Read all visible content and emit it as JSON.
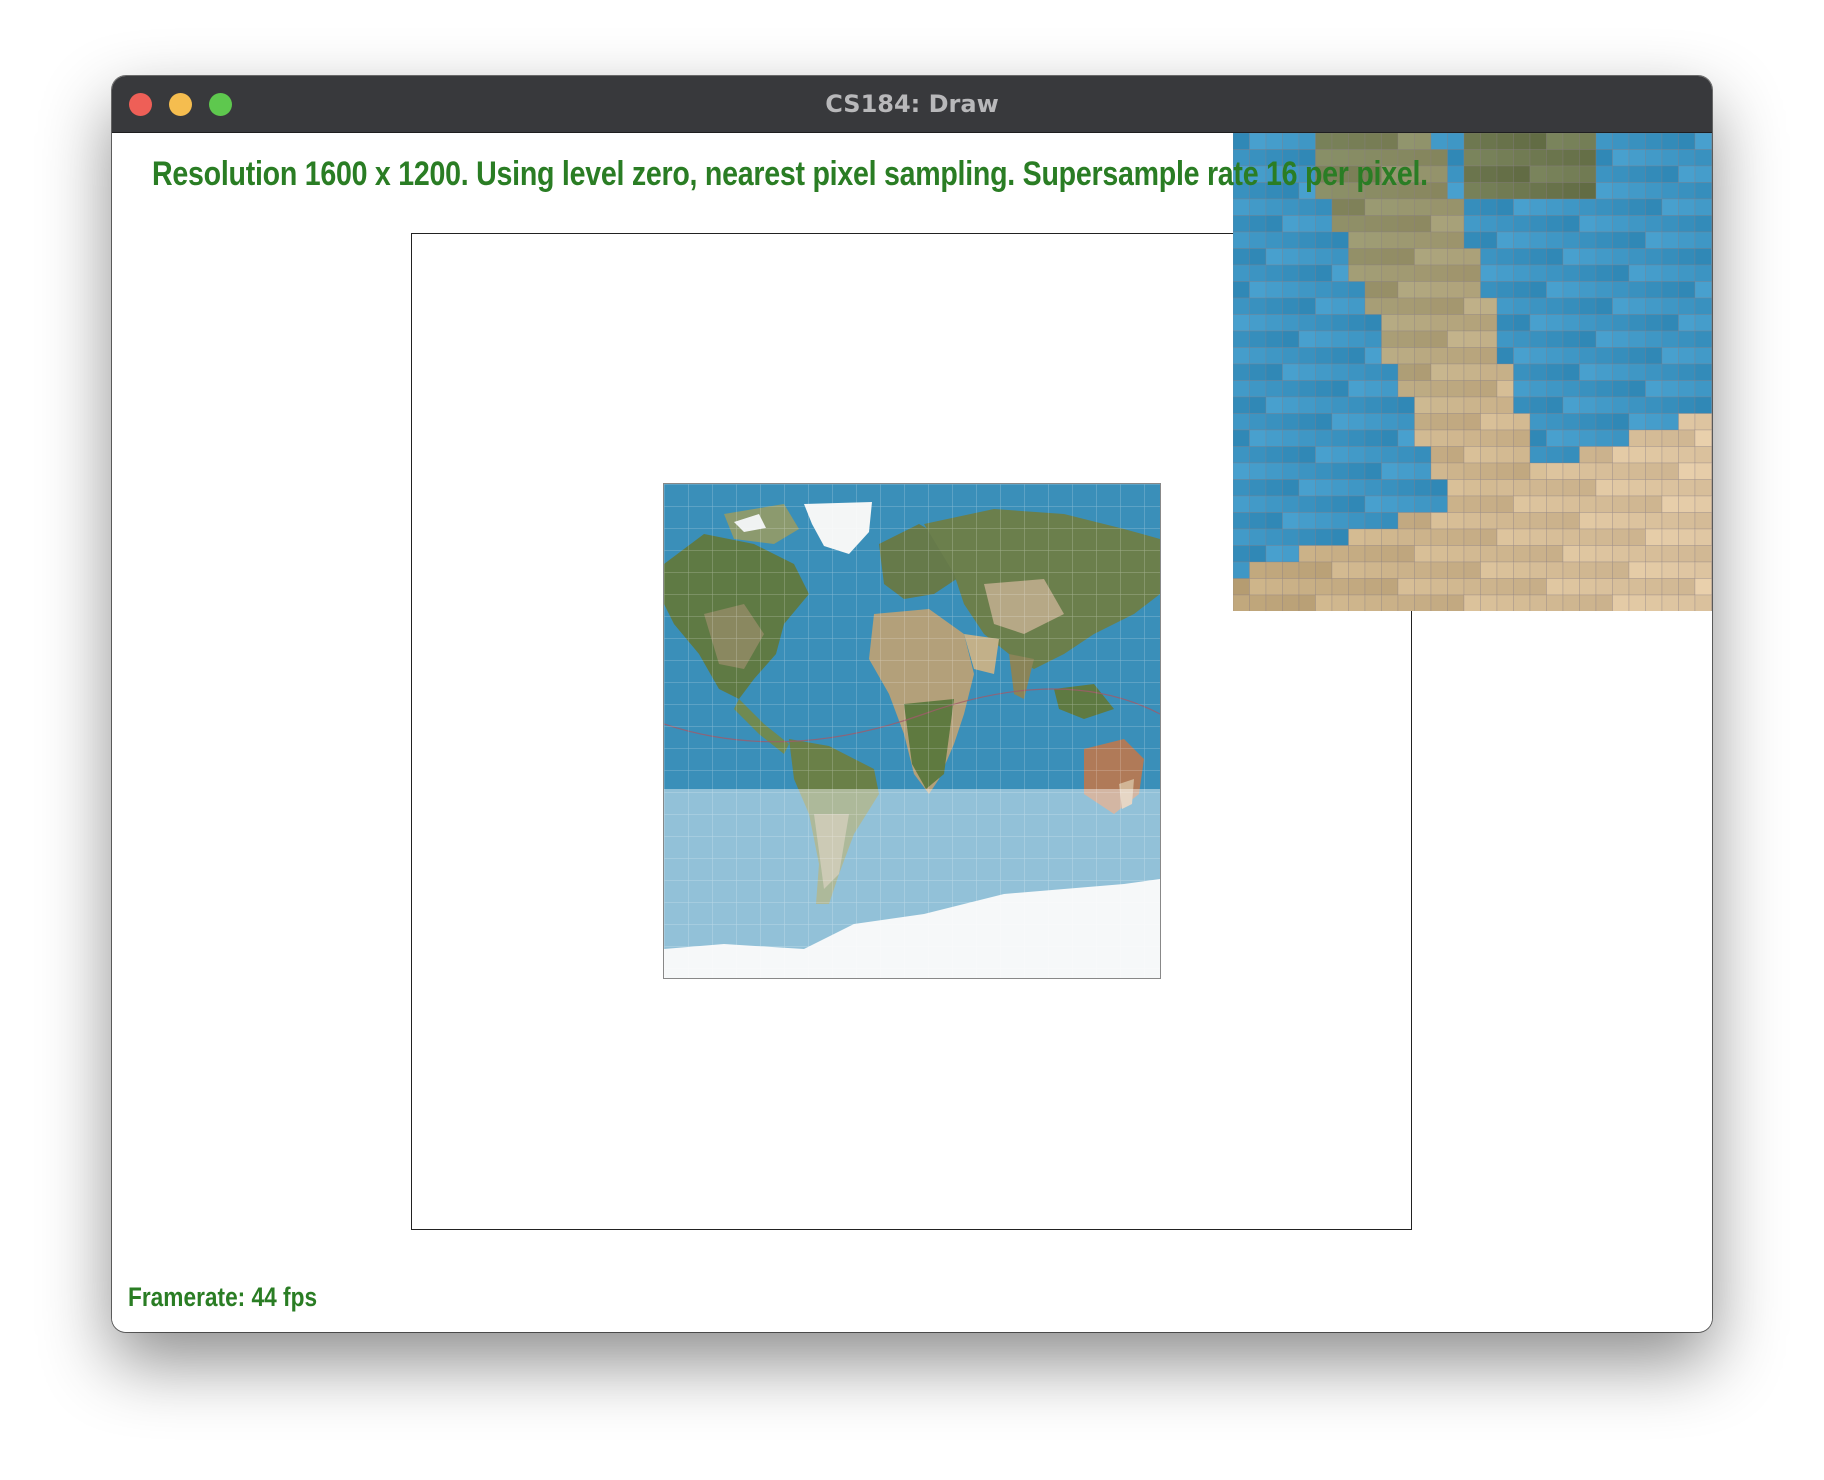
{
  "window": {
    "title": "CS184: Draw"
  },
  "status": {
    "info_text": "Resolution 1600 x 1200. Using level zero, nearest pixel sampling. Supersample rate 16 per pixel.",
    "framerate_text": "Framerate: 44 fps"
  },
  "colors": {
    "status_text": "#2a7d24",
    "ocean": "#3a8fb9",
    "titlebar": "#38393c"
  },
  "icons": {
    "close": "close-icon",
    "minimize": "minimize-icon",
    "maximize": "maximize-icon"
  }
}
